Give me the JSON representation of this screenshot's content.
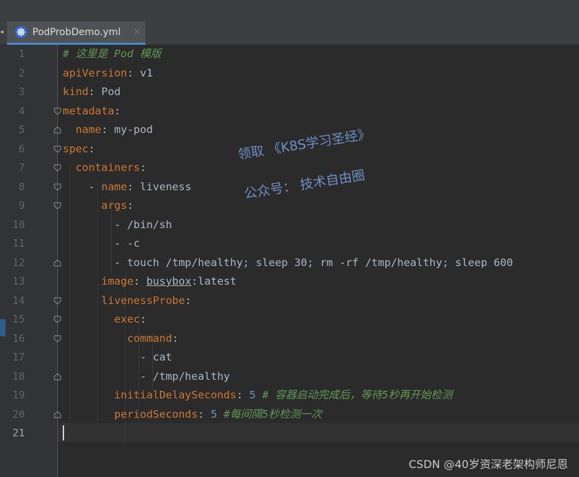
{
  "tabs": [
    {
      "title": "PodProbDemo.yml",
      "close": "×",
      "icon": "kubernetes-icon",
      "active": true
    }
  ],
  "tab_scroll_left": "◂",
  "editor": {
    "current_line": 21,
    "line_numbers": [
      "1",
      "2",
      "3",
      "4",
      "5",
      "6",
      "7",
      "8",
      "9",
      "10",
      "11",
      "12",
      "13",
      "14",
      "15",
      "16",
      "17",
      "18",
      "19",
      "20",
      "21"
    ],
    "lines": [
      [
        {
          "t": "# 这里是 Pod 模版",
          "c": "cmt"
        }
      ],
      [
        {
          "t": "apiVersion",
          "c": "k"
        },
        {
          "t": ": v1"
        }
      ],
      [
        {
          "t": "kind",
          "c": "k"
        },
        {
          "t": ": Pod"
        }
      ],
      [
        {
          "t": "metadata",
          "c": "k"
        },
        {
          "t": ":"
        }
      ],
      [
        {
          "t": "  "
        },
        {
          "t": "name",
          "c": "k"
        },
        {
          "t": ": my-pod"
        }
      ],
      [
        {
          "t": "spec",
          "c": "k"
        },
        {
          "t": ":"
        }
      ],
      [
        {
          "t": "  "
        },
        {
          "t": "containers",
          "c": "k"
        },
        {
          "t": ":"
        }
      ],
      [
        {
          "t": "    - "
        },
        {
          "t": "name",
          "c": "k"
        },
        {
          "t": ": liveness"
        }
      ],
      [
        {
          "t": "      "
        },
        {
          "t": "args",
          "c": "k"
        },
        {
          "t": ":"
        }
      ],
      [
        {
          "t": "        - /bin/sh"
        }
      ],
      [
        {
          "t": "        - -c"
        }
      ],
      [
        {
          "t": "        - touch /tmp/healthy; sleep 30; rm -rf /tmp/healthy; sleep 600"
        }
      ],
      [
        {
          "t": "      "
        },
        {
          "t": "image",
          "c": "k"
        },
        {
          "t": ": "
        },
        {
          "t": "busybox",
          "c": "ul"
        },
        {
          "t": ":latest"
        }
      ],
      [
        {
          "t": "      "
        },
        {
          "t": "livenessProbe",
          "c": "k"
        },
        {
          "t": ":"
        }
      ],
      [
        {
          "t": "        "
        },
        {
          "t": "exec",
          "c": "k"
        },
        {
          "t": ":"
        }
      ],
      [
        {
          "t": "          "
        },
        {
          "t": "command",
          "c": "k"
        },
        {
          "t": ":"
        }
      ],
      [
        {
          "t": "            - cat"
        }
      ],
      [
        {
          "t": "            - /tmp/healthy"
        }
      ],
      [
        {
          "t": "        "
        },
        {
          "t": "initialDelaySeconds",
          "c": "k"
        },
        {
          "t": ": "
        },
        {
          "t": "5",
          "c": "num"
        },
        {
          "t": " "
        },
        {
          "t": "# 容器启动完成后，等待5秒再开始检测",
          "c": "cmt"
        }
      ],
      [
        {
          "t": "        "
        },
        {
          "t": "periodSeconds",
          "c": "k"
        },
        {
          "t": ": "
        },
        {
          "t": "5",
          "c": "num"
        },
        {
          "t": " "
        },
        {
          "t": "#每间隔5秒检测一次",
          "c": "cmt"
        }
      ],
      []
    ]
  },
  "watermark": {
    "line1": "领取 《K8S学习圣经》",
    "line2": "公众号： 技术自由圈"
  },
  "footer_credit": "CSDN @40岁资深老架构师尼恩",
  "colors": {
    "background": "#2b2b2b",
    "gutter": "#313335",
    "keyword": "#cc7832",
    "comment": "#629755",
    "number": "#6897bb",
    "text": "#a9b7c6",
    "accent": "#4a88c7"
  }
}
